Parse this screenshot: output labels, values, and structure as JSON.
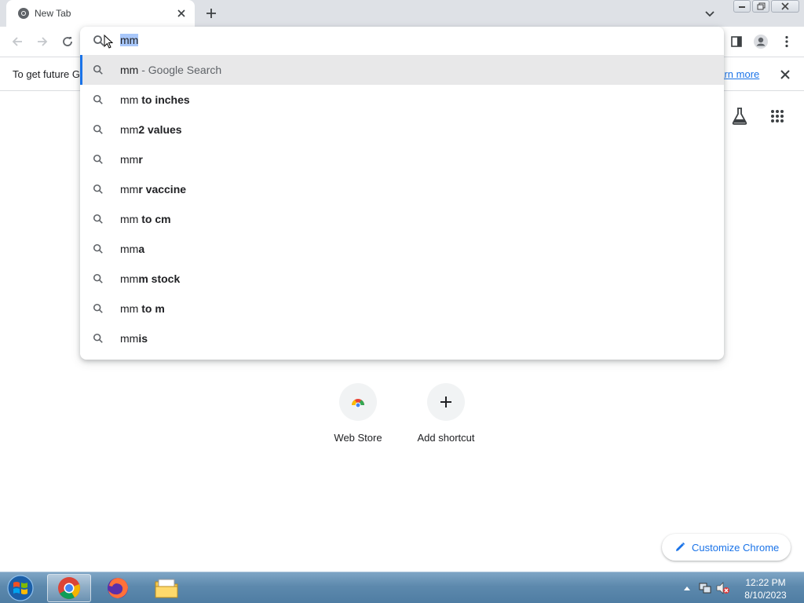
{
  "window": {
    "tab_title": "New Tab",
    "tab_icon": "chrome-icon",
    "controls": [
      "minimize-icon",
      "restore-icon",
      "close-icon"
    ]
  },
  "toolbar": {
    "back_icon": "back-arrow-icon",
    "forward_icon": "forward-arrow-icon",
    "reload_icon": "reload-icon",
    "side_panel_icon": "side-panel-icon",
    "profile_icon": "profile-icon",
    "menu_icon": "kebab-menu-icon"
  },
  "infobar": {
    "text": "To get future G",
    "link": "earn more"
  },
  "omnibox": {
    "input_value": "mm",
    "suggestions": [
      {
        "typed": "mm",
        "bold": "",
        "desc": " - Google Search"
      },
      {
        "typed": "mm",
        "bold": " to inches",
        "desc": ""
      },
      {
        "typed": "mm",
        "bold": "2 values",
        "desc": ""
      },
      {
        "typed": "mm",
        "bold": "r",
        "desc": ""
      },
      {
        "typed": "mm",
        "bold": "r vaccine",
        "desc": ""
      },
      {
        "typed": "mm",
        "bold": " to cm",
        "desc": ""
      },
      {
        "typed": "mm",
        "bold": "a",
        "desc": ""
      },
      {
        "typed": "mm",
        "bold": "m stock",
        "desc": ""
      },
      {
        "typed": "mm",
        "bold": " to m",
        "desc": ""
      },
      {
        "typed": "mm",
        "bold": "is",
        "desc": ""
      }
    ]
  },
  "ntp": {
    "shortcuts": [
      {
        "label": "Web Store",
        "icon": "web-store-icon"
      },
      {
        "label": "Add shortcut",
        "icon": "plus-icon"
      }
    ],
    "customize_label": "Customize Chrome",
    "labs_icon": "flask-icon",
    "apps_icon": "apps-grid-icon"
  },
  "taskbar": {
    "apps": [
      "chrome-icon",
      "firefox-icon",
      "file-explorer-icon"
    ],
    "time": "12:22 PM",
    "date": "8/10/2023"
  },
  "colors": {
    "accent": "#1a73e8",
    "tabstrip": "#dee1e6",
    "taskbar": "#5d89ad"
  }
}
